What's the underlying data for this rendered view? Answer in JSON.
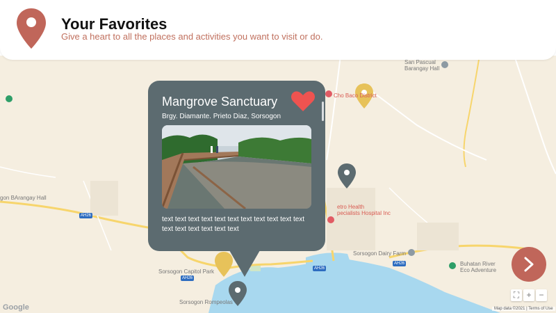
{
  "header": {
    "title": "Your Favorites",
    "subtitle": "Give a heart to all the places and activities you want to visit or do.",
    "pin_color": "#c0665a"
  },
  "popup": {
    "title": "Mangrove Sanctuary",
    "address": "Brgy. Diamante. Prieto Diaz, Sorsogon",
    "description": "text text text text text text text text text text text text text text text text text",
    "heart_color": "#ef5350",
    "background_color": "#5c6b70",
    "favorited": true
  },
  "map": {
    "labels": {
      "san_pascual": "San Pascual\nBarangay Hall",
      "cho_baco": "Cho Baco District",
      "bagongbayan": "gon BArangay Hall",
      "metro_health": "etro Health\npecialists Hospital Inc",
      "dairy_farm": "Sorsogon Dairy Farm",
      "buhatan": "Buhatan River\nEco Adventure",
      "capitol_park": "Sorsogon Capitol Park",
      "rompeolas": "Sorsogon Rompeolas",
      "road_ah26_a": "AH26",
      "road_ah26_b": "AH26",
      "road_ah26_c": "AH26",
      "road_ah26_d": "AH26"
    },
    "marker_colors": {
      "yellow": "#e7c25a",
      "gray": "#5c6b70"
    },
    "controls": {
      "fullscreen": "⛶",
      "zoom_in": "+",
      "zoom_out": "−"
    },
    "google_logo": "Google",
    "attribution": "Map data ©2021 | Terms of Use"
  },
  "nav": {
    "next_label": "next"
  }
}
